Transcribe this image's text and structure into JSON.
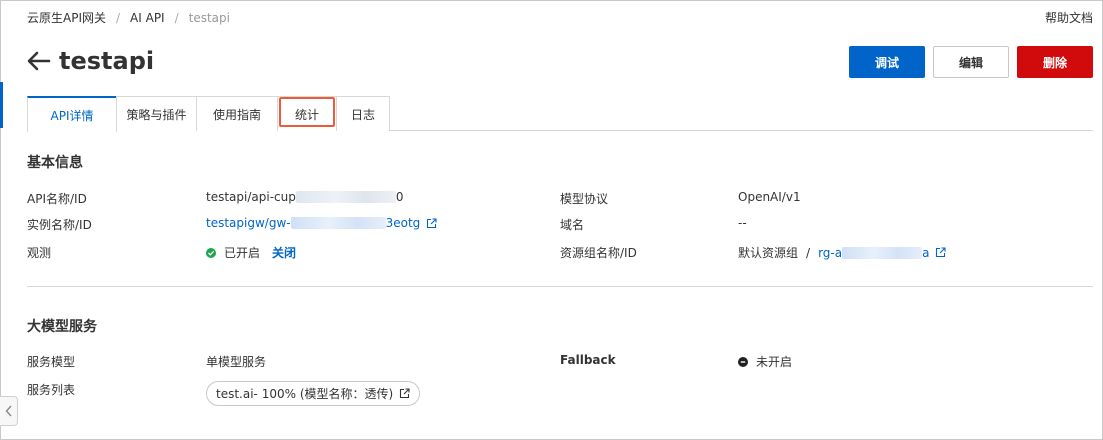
{
  "breadcrumb": {
    "items": [
      "云原生API网关",
      "AI API",
      "testapi"
    ]
  },
  "header": {
    "help_label": "帮助文档",
    "title": "testapi"
  },
  "actions": {
    "debug_label": "调试",
    "edit_label": "编辑",
    "delete_label": "删除"
  },
  "tabs": [
    {
      "label": "API详情",
      "active": true
    },
    {
      "label": "策略与插件",
      "active": false
    },
    {
      "label": "使用指南",
      "active": false
    },
    {
      "label": "统计",
      "active": false,
      "highlighted": true
    },
    {
      "label": "日志",
      "active": false
    }
  ],
  "basic_info": {
    "title": "基本信息",
    "api_name_label": "API名称/ID",
    "api_name_value_prefix": "testapi/api-cup",
    "api_name_value_suffix": "0",
    "protocol_label": "模型协议",
    "protocol_value": "OpenAI/v1",
    "instance_label": "实例名称/ID",
    "instance_value_prefix": "testapigw/gw-",
    "instance_value_suffix": "3eotg",
    "domain_label": "域名",
    "domain_value": "--",
    "observe_label": "观测",
    "observe_status": "已开启",
    "observe_action": "关闭",
    "resource_group_label": "资源组名称/ID",
    "resource_group_name": "默认资源组",
    "resource_group_slash": "/",
    "resource_group_id_prefix": "rg-a",
    "resource_group_id_suffix": "a"
  },
  "llm_service": {
    "title": "大模型服务",
    "service_model_label": "服务模型",
    "service_model_value": "单模型服务",
    "fallback_label": "Fallback",
    "fallback_value": "未开启",
    "service_list_label": "服务列表",
    "service_list_item": "test.ai- 100% (模型名称：透传)"
  },
  "colors": {
    "accent": "#0064c8",
    "danger": "#d10b0b",
    "success": "#1fa64a",
    "highlight": "#e85d3c"
  },
  "icons": [
    "arrow-left-icon",
    "external-link-icon",
    "check-circle-icon",
    "minus-circle-icon",
    "chevron-left-icon"
  ]
}
